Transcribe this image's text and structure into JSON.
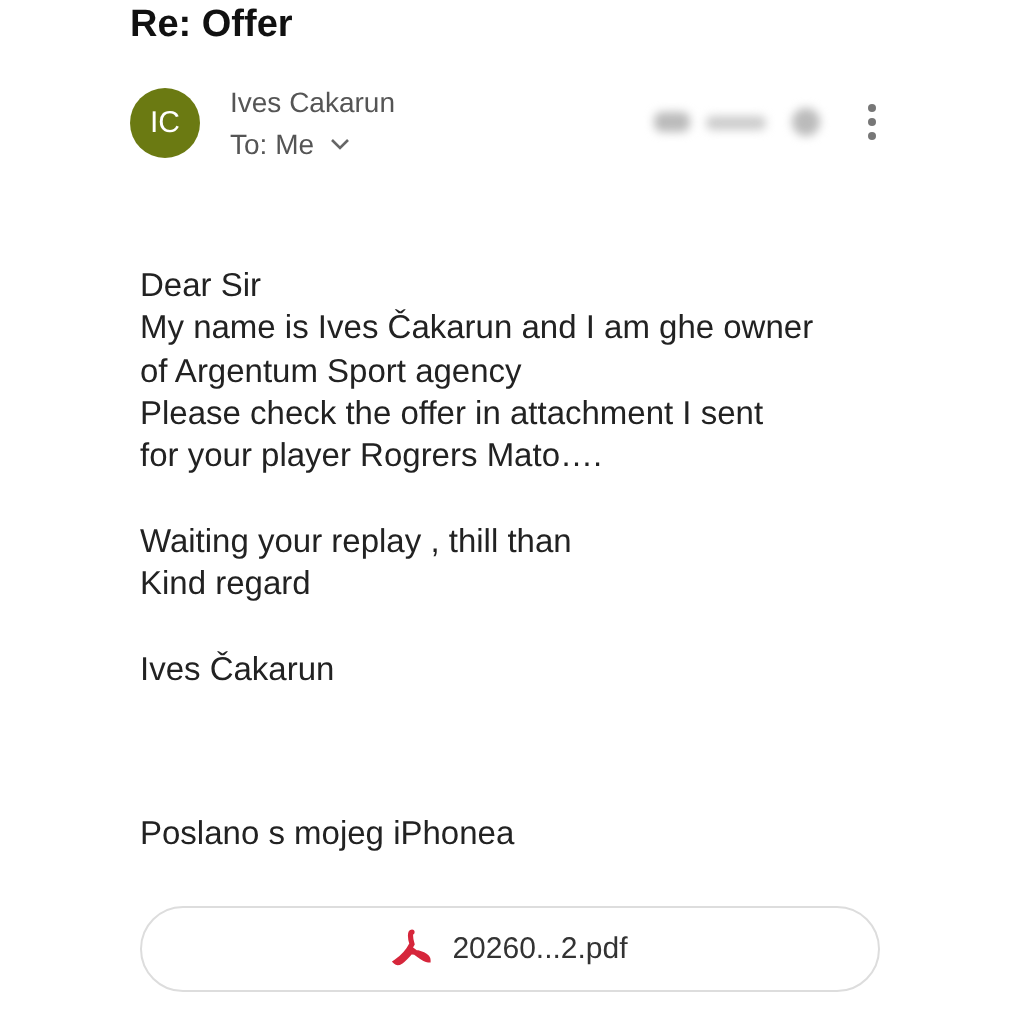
{
  "email": {
    "subject": "Re: Offer",
    "sender": {
      "initials": "IC",
      "color": "#6b7a12",
      "name": "Ives Cakarun",
      "recipient": "To: Me"
    },
    "body": [
      [
        "Dear Sir",
        "My name is Ives Čakarun and I am ghe owner",
        "of Argentum Sport agency",
        "Please check the offer in attachment I sent",
        "for your player Rogrers Mato…."
      ],
      [
        "Waiting your replay , thill than",
        "Kind regard"
      ],
      [
        "Ives Čakarun"
      ]
    ],
    "signature": "Poslano s mojeg iPhonea",
    "attachment": {
      "kind": "pdf",
      "name": "20260...2.pdf"
    }
  }
}
